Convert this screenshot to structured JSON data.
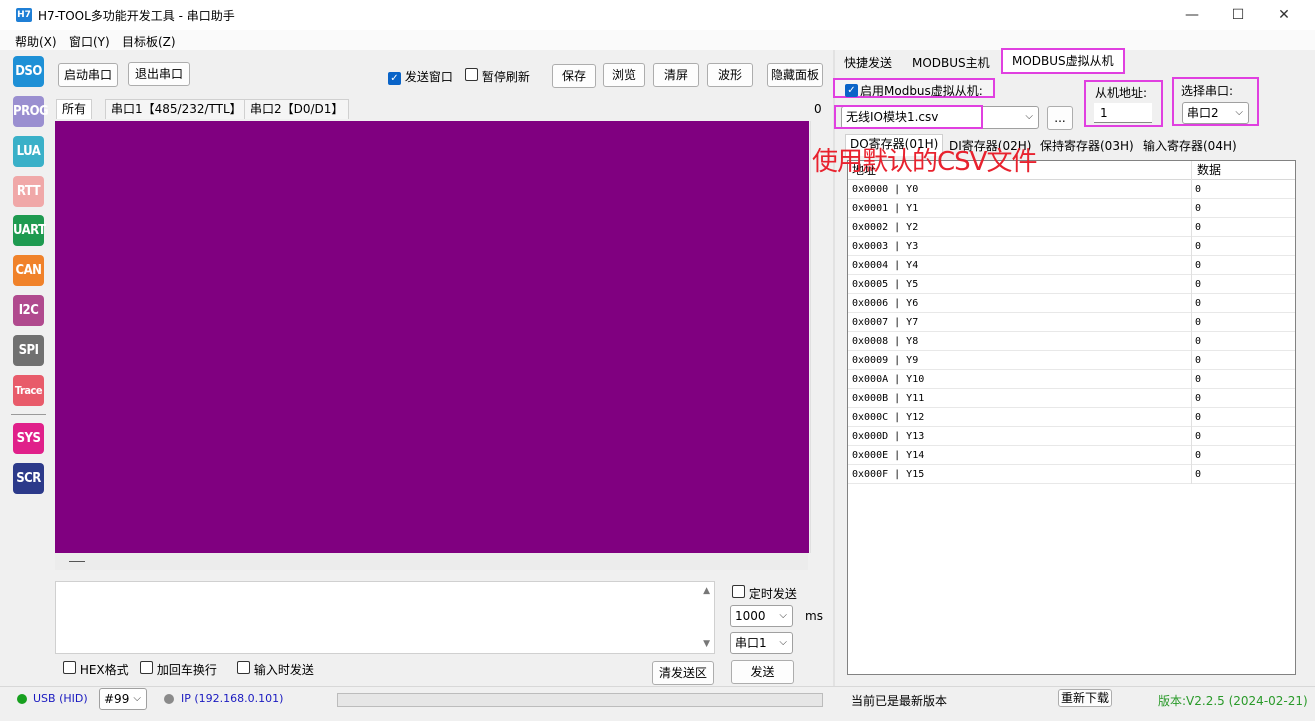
{
  "window": {
    "icon_text": "H7",
    "title": "H7-TOOL多功能开发工具 - 串口助手",
    "minimize": "—",
    "maximize": "☐",
    "close": "✕"
  },
  "menu": [
    "帮助(X)",
    "窗口(Y)",
    "目标板(Z)"
  ],
  "tools": [
    {
      "label": "DSO",
      "color": "#1e90d6"
    },
    {
      "label": "PROG",
      "color": "#9a8fd0"
    },
    {
      "label": "LUA",
      "color": "#3ab0c8"
    },
    {
      "label": "RTT",
      "color": "#f0a8a8"
    },
    {
      "label": "UART",
      "color": "#1e9a50"
    },
    {
      "label": "CAN",
      "color": "#f0822a"
    },
    {
      "label": "I2C",
      "color": "#b04a8e"
    },
    {
      "label": "SPI",
      "color": "#707070"
    },
    {
      "label": "Trace",
      "color": "#e85b6a"
    },
    {
      "label": "SYS",
      "color": "#e0208a"
    },
    {
      "label": "SCR",
      "color": "#2c3a8a"
    }
  ],
  "toolbar": {
    "start_port": "启动串口",
    "exit_port": "退出串口",
    "send_window": "发送窗口",
    "pause_refresh": "暂停刷新",
    "save": "保存",
    "browse": "浏览",
    "clear": "清屏",
    "waveform": "波形",
    "hide_panel": "隐藏面板"
  },
  "receive_tabs": [
    "所有",
    "串口1【485/232/TTL】",
    "串口2【D0/D1】"
  ],
  "receive_count": "0",
  "send": {
    "timed_send": "定时发送",
    "interval": "1000",
    "unit": "ms",
    "port": "串口1",
    "hex": "HEX格式",
    "crlf": "加回车换行",
    "send_on_input": "输入时发送",
    "clear_send": "清发送区",
    "send_button": "发送"
  },
  "right_tabs": [
    "快捷发送",
    "MODBUS主机",
    "MODBUS虚拟从机"
  ],
  "modbus": {
    "enable_label": "启用Modbus虚拟从机:",
    "file": "无线IO模块1.csv",
    "browse_button": "...",
    "slave_addr_label": "从机地址:",
    "slave_addr": "1",
    "port_label": "选择串口:",
    "port": "串口2",
    "register_tabs": [
      "DO寄存器(01H)",
      "DI寄存器(02H)",
      "保持寄存器(03H)",
      "输入寄存器(04H)"
    ],
    "col_addr": "地址",
    "col_data": "数据",
    "rows": [
      {
        "addr": "0x0000 | Y0",
        "val": "0"
      },
      {
        "addr": "0x0001 | Y1",
        "val": "0"
      },
      {
        "addr": "0x0002 | Y2",
        "val": "0"
      },
      {
        "addr": "0x0003 | Y3",
        "val": "0"
      },
      {
        "addr": "0x0004 | Y4",
        "val": "0"
      },
      {
        "addr": "0x0005 | Y5",
        "val": "0"
      },
      {
        "addr": "0x0006 | Y6",
        "val": "0"
      },
      {
        "addr": "0x0007 | Y7",
        "val": "0"
      },
      {
        "addr": "0x0008 | Y8",
        "val": "0"
      },
      {
        "addr": "0x0009 | Y9",
        "val": "0"
      },
      {
        "addr": "0x000A | Y10",
        "val": "0"
      },
      {
        "addr": "0x000B | Y11",
        "val": "0"
      },
      {
        "addr": "0x000C | Y12",
        "val": "0"
      },
      {
        "addr": "0x000D | Y13",
        "val": "0"
      },
      {
        "addr": "0x000E | Y14",
        "val": "0"
      },
      {
        "addr": "0x000F | Y15",
        "val": "0"
      }
    ]
  },
  "annotation": "使用默认的CSV文件",
  "status": {
    "usb": "USB (HID)",
    "device": "#99",
    "ip": "IP (192.168.0.101)",
    "update_msg": "当前已是最新版本",
    "redownload": "重新下载",
    "version": "版本:V2.2.5 (2024-02-21)"
  },
  "colors": {
    "receive_bg": "#800080",
    "highlight": "#e040e0",
    "annotation": "#e8222e",
    "version": "#2a9a2a"
  }
}
